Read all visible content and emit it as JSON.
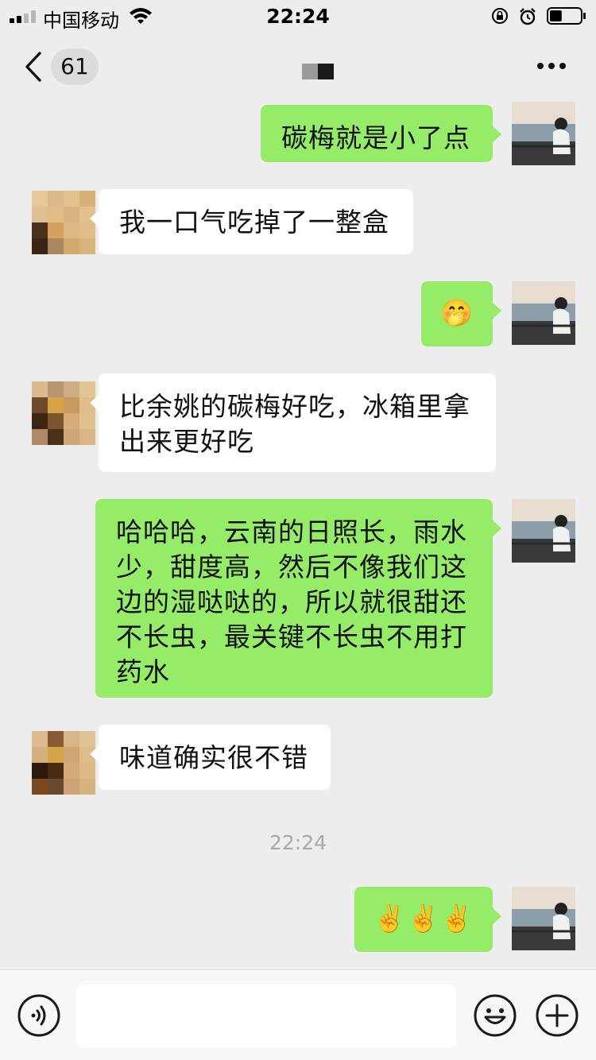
{
  "status_bar": {
    "carrier": "中国移动",
    "time": "22:24",
    "icons": [
      "signal-icon",
      "wifi-icon",
      "orientation-lock-icon",
      "alarm-icon",
      "battery-icon"
    ],
    "battery_level": 0.4
  },
  "nav": {
    "back_icon": "chevron-left-icon",
    "unread_count": "61",
    "more_icon": "more-dots-icon"
  },
  "messages": [
    {
      "from": "me",
      "text": "碳梅就是小了点"
    },
    {
      "from": "them",
      "text": "我一口气吃掉了一整盒"
    },
    {
      "from": "me",
      "text": "🤭"
    },
    {
      "from": "them",
      "text": "比余姚的碳梅好吃，冰箱里拿出来更好吃"
    },
    {
      "from": "me",
      "text": "哈哈哈，云南的日照长，雨水少，甜度高，然后不像我们这边的湿哒哒的，所以就很甜还不长虫，最关键不长虫不用打药水"
    },
    {
      "from": "them",
      "text": "味道确实很不错"
    },
    {
      "type": "timestamp",
      "text": "22:24"
    },
    {
      "from": "me",
      "text": "✌️✌️✌️"
    }
  ],
  "input_bar": {
    "voice_icon": "voice-icon",
    "emoji_icon": "emoji-icon",
    "plus_icon": "plus-icon",
    "input_value": ""
  },
  "colors": {
    "background": "#ededed",
    "my_bubble": "#95ec69",
    "their_bubble": "#ffffff",
    "timestamp": "#a8a8a8"
  }
}
